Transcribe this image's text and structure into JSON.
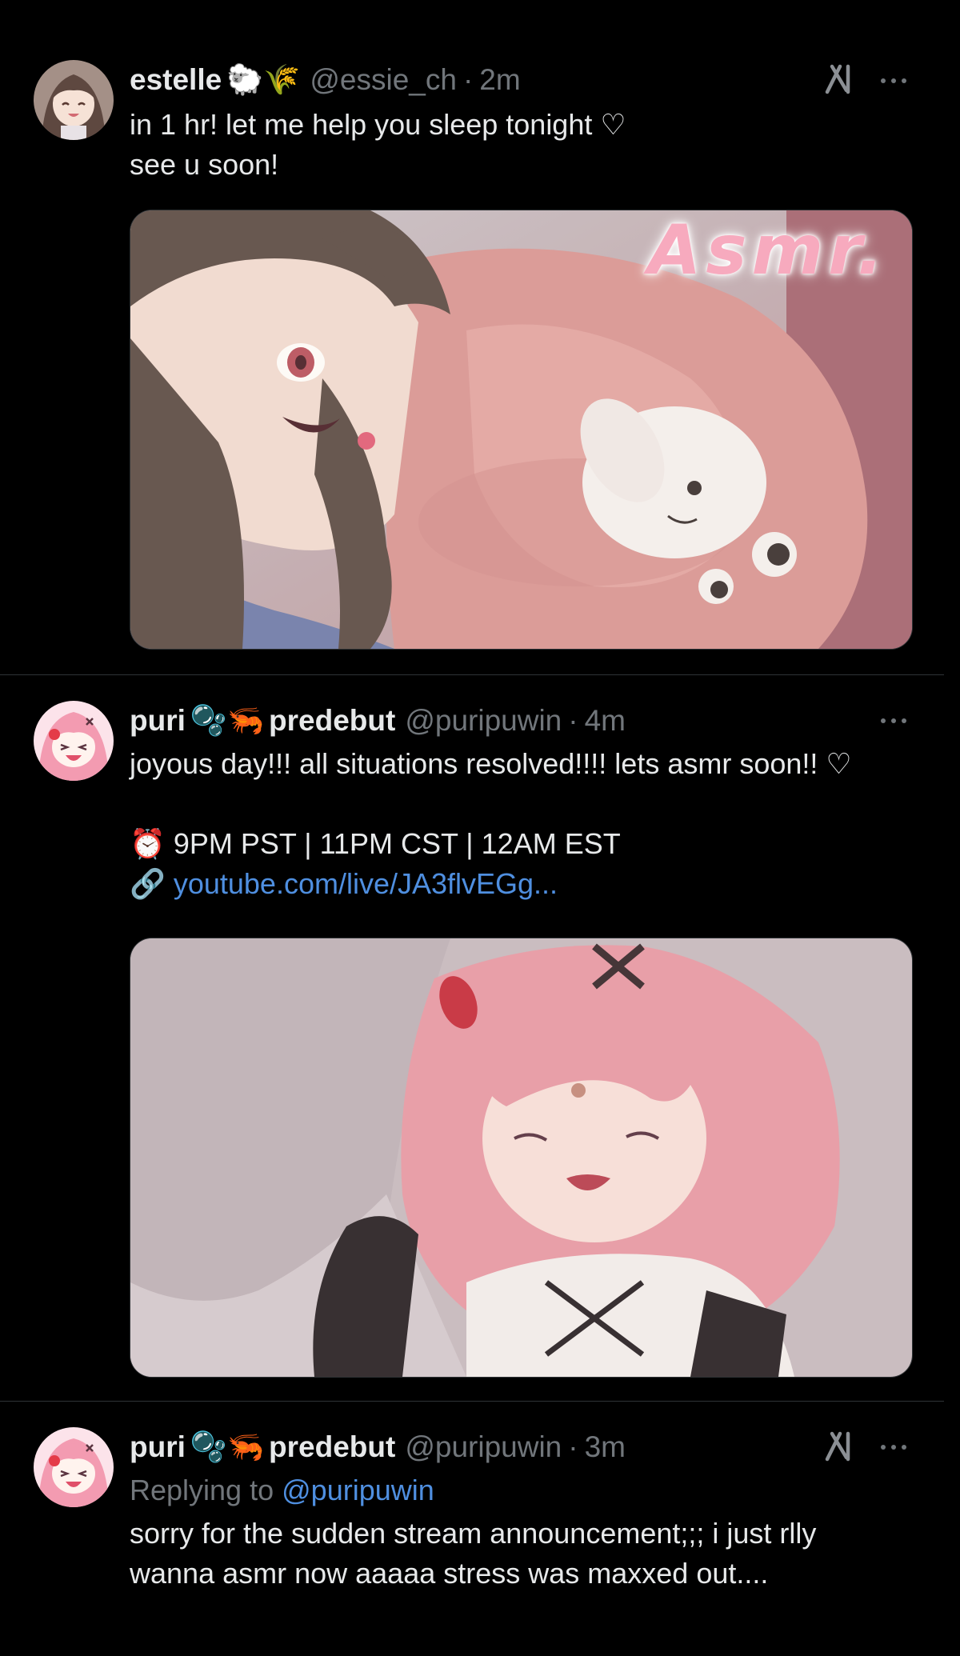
{
  "tweets": [
    {
      "name": "estelle",
      "name_emoji": "🐑🌾",
      "handle": "@essie_ch",
      "time": "2m",
      "lines": [
        "in 1 hr! let me help you sleep tonight ♡",
        "see u soon!"
      ],
      "media": {
        "alt": "Anime-style illustration of a girl with dark hair hugging a plush toy",
        "overlay_text": "Asmr."
      }
    },
    {
      "name": "puri",
      "name_emoji": "🫧🦐",
      "name_suffix": "predebut",
      "handle": "@puripuwin",
      "time": "4m",
      "lines": [
        "joyous day!!! all situations resolved!!!! lets asmr soon!! ♡"
      ],
      "schedule": {
        "icon": "⏰",
        "text": "9PM PST | 11PM CST | 12AM EST"
      },
      "link": {
        "icon": "🔗",
        "text": "youtube.com/live/JA3flvEGg..."
      },
      "media": {
        "alt": "Anime-style illustration of a pink-haired girl sleeping"
      }
    },
    {
      "name": "puri",
      "name_emoji": "🫧🦐",
      "name_suffix": "predebut",
      "handle": "@puripuwin",
      "time": "3m",
      "replying_label": "Replying to",
      "replying_to": "@puripuwin",
      "lines": [
        "sorry for the sudden stream announcement;;; i just rlly",
        "wanna asmr now aaaaa stress was maxxed out...."
      ]
    }
  ],
  "separator": "·",
  "colors": {
    "background": "#000000",
    "text": "#e7e9ea",
    "muted": "#71767b",
    "link": "#4f8fe0",
    "divider": "#2f3336"
  },
  "icons": {
    "grok": "grok-icon",
    "more": "more-icon",
    "alarm": "alarm-clock-icon",
    "link": "link-icon"
  }
}
